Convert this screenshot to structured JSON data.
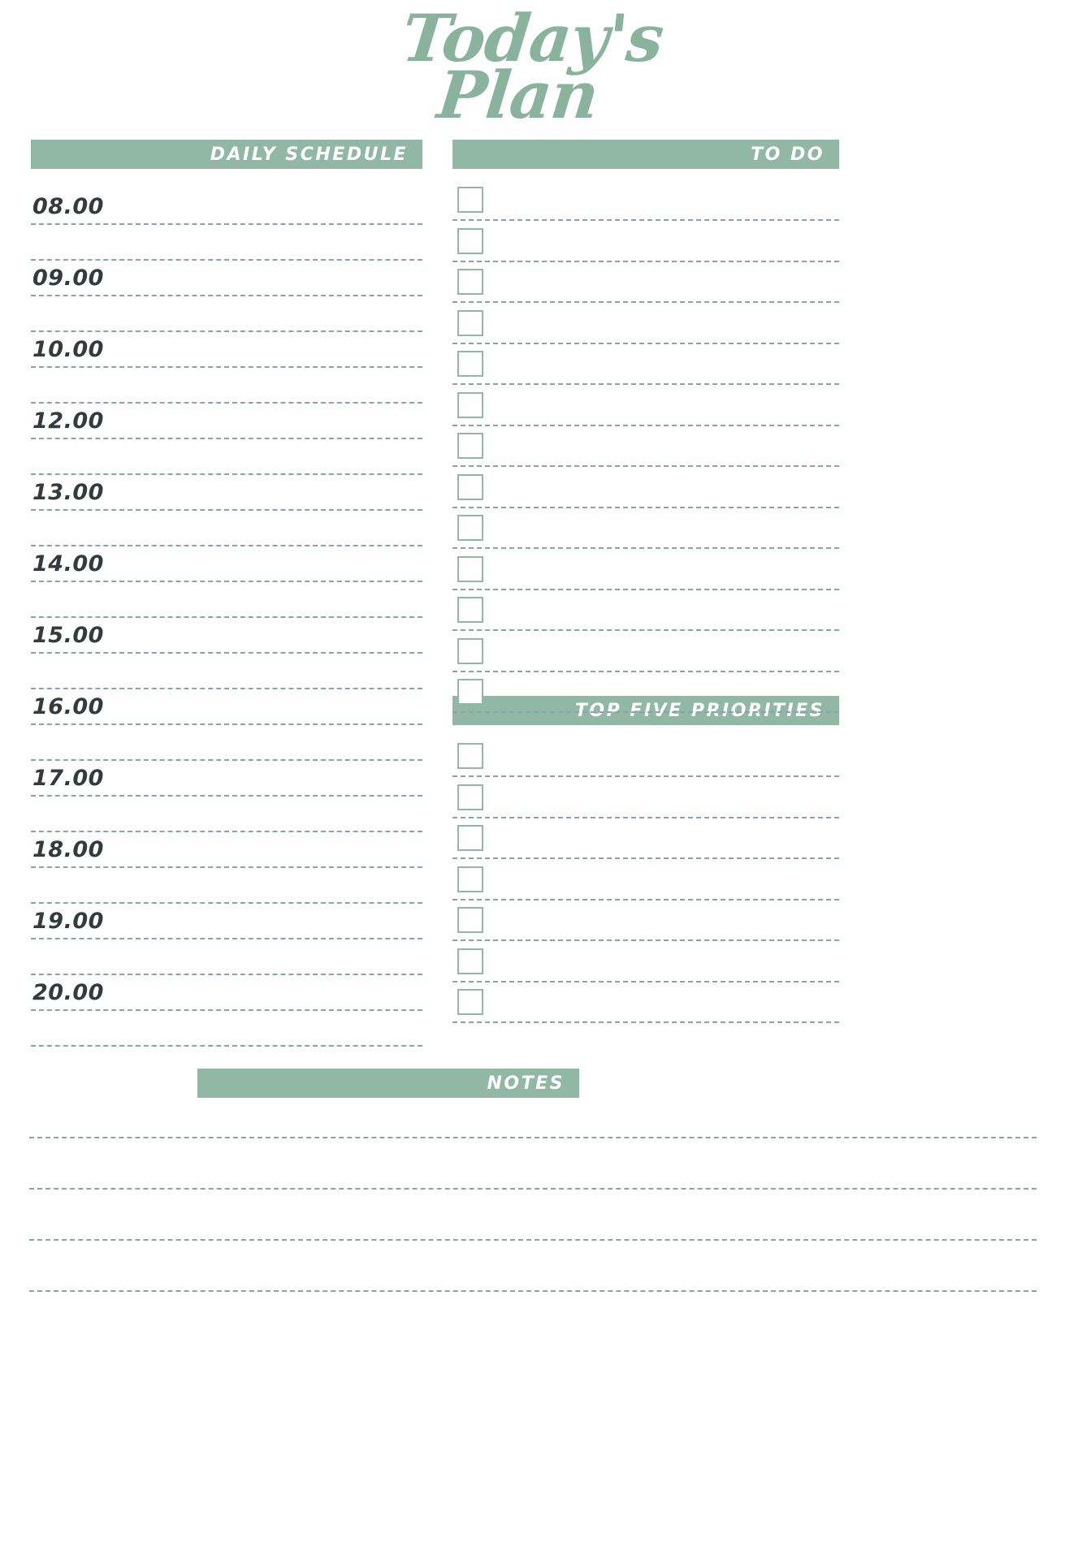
{
  "title": {
    "line1": "Today's",
    "line2": "Plan"
  },
  "sections": {
    "schedule": {
      "header": "DAILY SCHEDULE"
    },
    "todo": {
      "header": "TO DO"
    },
    "priorities": {
      "header": "TOP FIVE PRIORITIES"
    },
    "notes": {
      "header": "NOTES"
    }
  },
  "schedule": {
    "times": [
      "08.00",
      "09.00",
      "10.00",
      "12.00",
      "13.00",
      "14.00",
      "15.00",
      "16.00",
      "17.00",
      "18.00",
      "19.00",
      "20.00"
    ],
    "line_count": 24
  },
  "todo": {
    "checkbox_count": 13,
    "line_count": 13
  },
  "priorities": {
    "checkbox_count": 7,
    "line_count": 7
  },
  "notes": {
    "line_count": 4
  },
  "colors": {
    "accent": "#90b8a4",
    "title": "#8ab39e",
    "rule": "#8ba3a7",
    "time_text": "#333b3c",
    "header_text": "#ffffff",
    "background": "#ffffff"
  }
}
